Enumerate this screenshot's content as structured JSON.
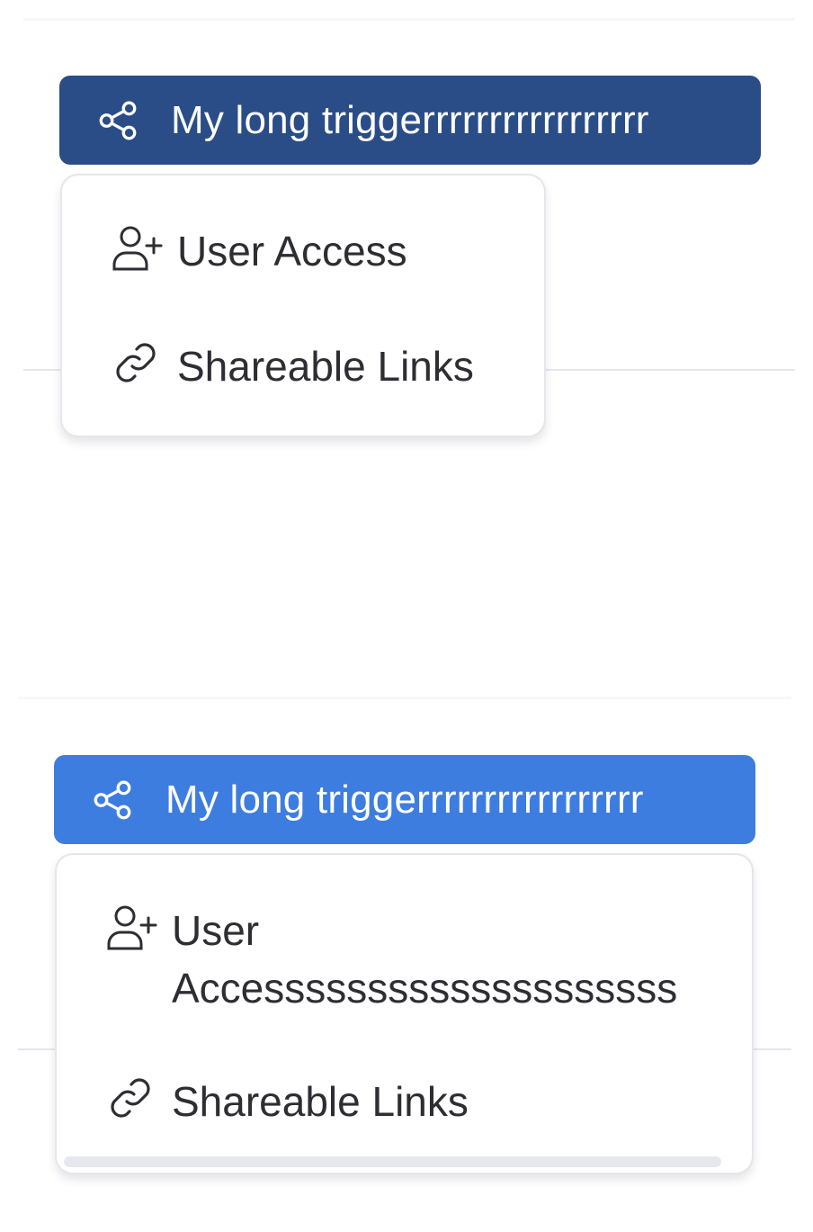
{
  "colors": {
    "trigger_dark": "#2a4d87",
    "trigger_light": "#3d7ddf",
    "menu_text": "#2d2d33"
  },
  "example1": {
    "trigger": {
      "label": "My long triggerrrrrrrrrrrrrrrrr",
      "icon": "share-icon"
    },
    "items": [
      {
        "label": "User Access",
        "icon": "user-plus-icon"
      },
      {
        "label": "Shareable Links",
        "icon": "link-icon"
      }
    ]
  },
  "example2": {
    "trigger": {
      "label": "My long triggerrrrrrrrrrrrrrrrr",
      "icon": "share-icon"
    },
    "items": [
      {
        "label_line1": "User",
        "label_line2": "Accessssssssssssssssssss",
        "icon": "user-plus-icon"
      },
      {
        "label": "Shareable Links",
        "icon": "link-icon"
      }
    ]
  }
}
